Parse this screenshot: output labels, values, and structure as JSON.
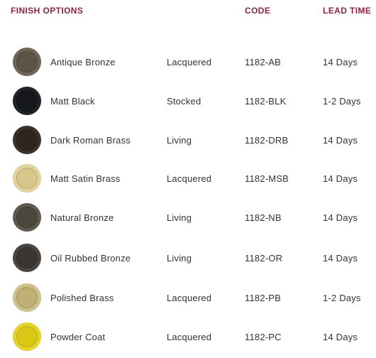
{
  "header": {
    "finish_label": "FINISH OPTIONS",
    "code_label": "CODE",
    "lead_label": "LEAD TIME",
    "color": "#8b2346"
  },
  "finishes": [
    {
      "name": "Antique Bronze",
      "type": "Lacquered",
      "code": "1182-AB",
      "lead": "14 Days",
      "outer": "#6e6556",
      "inner": "#5c5446"
    },
    {
      "name": "Matt Black",
      "type": "Stocked",
      "code": "1182-BLK",
      "lead": "1-2 Days",
      "outer": "#1f2226",
      "inner": "#15171a"
    },
    {
      "name": "Dark Roman Brass",
      "type": "Living",
      "code": "1182-DRB",
      "lead": "14 Days",
      "outer": "#3a3128",
      "inner": "#2e261e"
    },
    {
      "name": "Matt Satin Brass",
      "type": "Lacquered",
      "code": "1182-MSB",
      "lead": "14 Days",
      "outer": "#e2d29c",
      "inner": "#d8c68a"
    },
    {
      "name": "Natural Bronze",
      "type": "Living",
      "code": "1182-NB",
      "lead": "14 Days",
      "outer": "#5e594d",
      "inner": "#4c473c"
    },
    {
      "name": "Oil Rubbed Bronze",
      "type": "Living",
      "code": "1182-OR",
      "lead": "14 Days",
      "outer": "#4a4540",
      "inner": "#3b3631"
    },
    {
      "name": "Polished Brass",
      "type": "Lacquered",
      "code": "1182-PB",
      "lead": "1-2 Days",
      "outer": "#cdc08a",
      "inner": "#bfb173"
    },
    {
      "name": "Powder Coat",
      "type": "Lacquered",
      "code": "1182-PC",
      "lead": "14 Days",
      "outer": "#e5d52a",
      "inner": "#d9c816"
    }
  ]
}
